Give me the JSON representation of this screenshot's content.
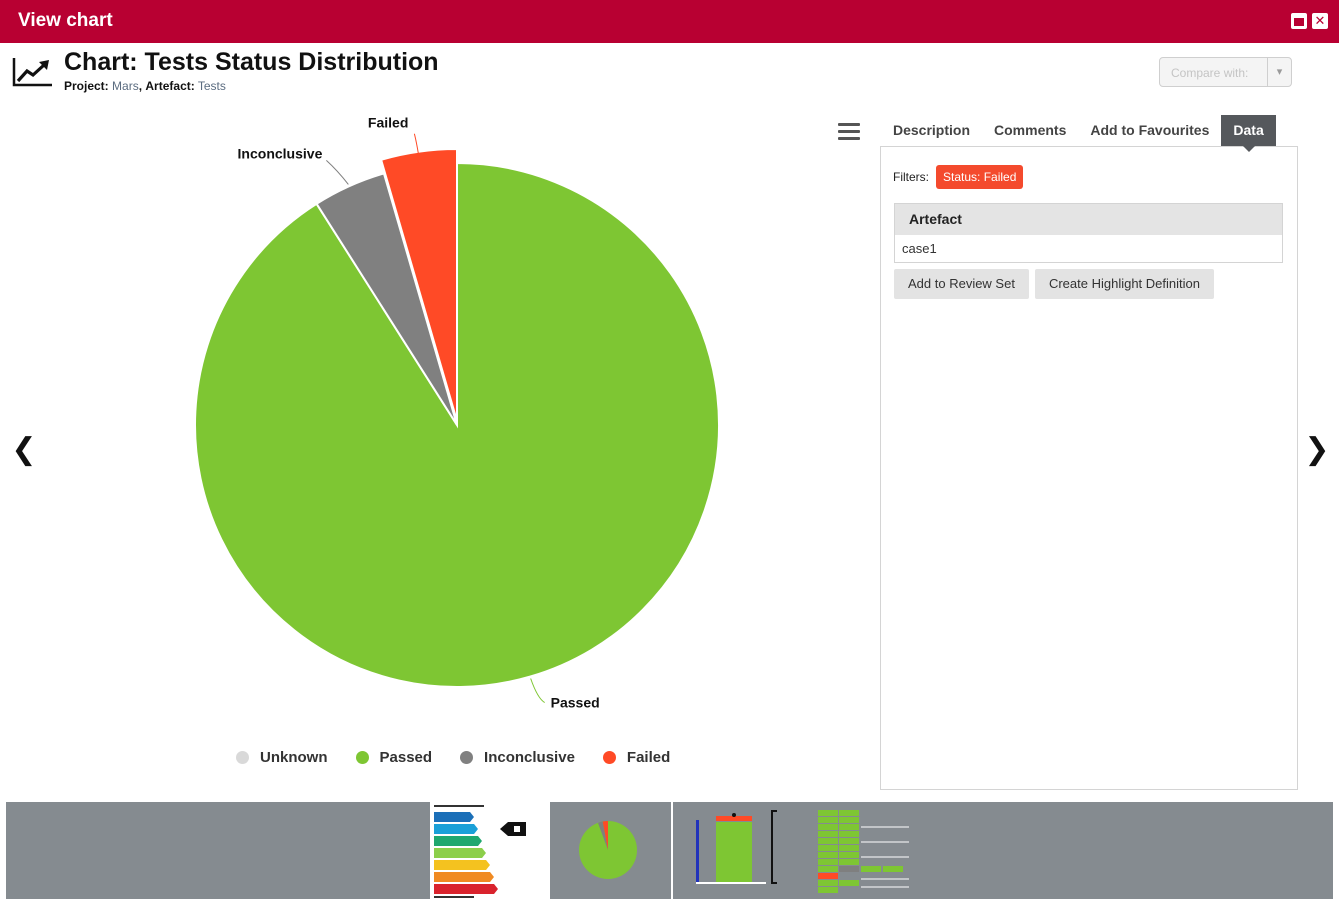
{
  "window": {
    "title": "View chart",
    "colors": {
      "titlebar": "#b80032"
    }
  },
  "header": {
    "title": "Chart: Tests Status Distribution",
    "project_label": "Project:",
    "project_value": "Mars",
    "sep": ",",
    "artefact_label": "Artefact:",
    "artefact_value": "Tests",
    "icon": "trend-chart-icon"
  },
  "compare": {
    "label": "Compare with:"
  },
  "chart_data": {
    "type": "pie",
    "title": "",
    "categories": [
      "Unknown",
      "Passed",
      "Inconclusive",
      "Failed"
    ],
    "values": [
      0,
      91,
      4.5,
      4.5
    ],
    "colors": [
      "#d9d9d9",
      "#7ec633",
      "#808080",
      "#ff4a26"
    ],
    "legend": "bottom",
    "slice_labels": [
      "Passed",
      "Inconclusive",
      "Failed"
    ]
  },
  "tabs": [
    {
      "label": "Description",
      "active": false
    },
    {
      "label": "Comments",
      "active": false
    },
    {
      "label": "Add to Favourites",
      "active": false
    },
    {
      "label": "Data",
      "active": true
    }
  ],
  "panel": {
    "filters_label": "Filters:",
    "filter_chip": "Status: Failed",
    "table": {
      "header": "Artefact",
      "rows": [
        "case1"
      ]
    },
    "buttons": {
      "review": "Add to Review Set",
      "highlight": "Create Highlight Definition"
    }
  },
  "nav": {
    "prev": "❮",
    "next": "❯"
  }
}
